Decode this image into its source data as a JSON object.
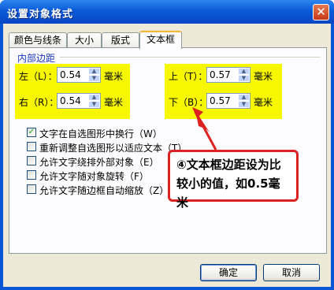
{
  "window": {
    "title": "设置对象格式",
    "close_glyph": "✕"
  },
  "tabs": [
    {
      "label": "颜色与线条",
      "active": false
    },
    {
      "label": "大小",
      "active": false
    },
    {
      "label": "版式",
      "active": false
    },
    {
      "label": "文本框",
      "active": true
    }
  ],
  "internal_margin": {
    "group_title": "内部边距",
    "left": {
      "label": "左（L）：",
      "value": "0.54",
      "unit": "毫米"
    },
    "right": {
      "label": "右（R）：",
      "value": "0.54",
      "unit": "毫米"
    },
    "top": {
      "label": "上（T）：",
      "value": "0.57",
      "unit": "毫米"
    },
    "bottom": {
      "label": "下（B）：",
      "value": "0.57",
      "unit": "毫米"
    },
    "highlight_color": "#f7f800"
  },
  "options": [
    {
      "label": "文字在自选图形中换行（W）",
      "checked": true
    },
    {
      "label": "重新调整自选图形以适应文本（T）",
      "checked": false
    },
    {
      "label": "允许文字绕排外部对象（E）",
      "checked": false
    },
    {
      "label": "允许文字随对象旋转（F）",
      "checked": false
    },
    {
      "label": "允许文字随边框自动缩放（Z）",
      "checked": false
    }
  ],
  "callout": {
    "line1": "④文本框边距设为比",
    "line2": "较小的值，如0.5毫米",
    "border_color": "#dd2222"
  },
  "buttons": {
    "ok": "确定",
    "cancel": "取消"
  },
  "colors": {
    "titlebar": "#0a57d6",
    "dialog_bg": "#ece9d8",
    "group_title": "#1a37c0"
  }
}
